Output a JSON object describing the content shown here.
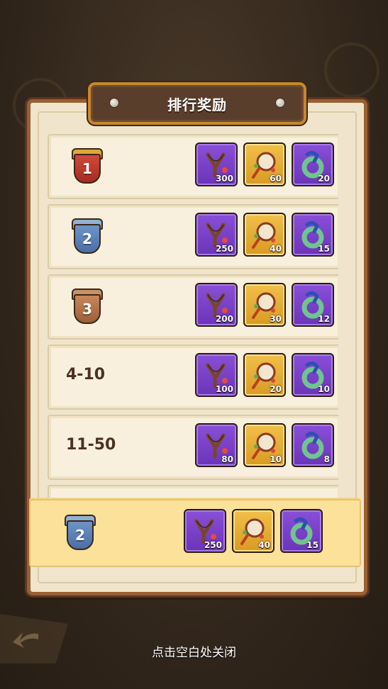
{
  "title": "排行奖励",
  "close_hint": "点击空白处关闭",
  "item_icons": [
    "slingshot-icon",
    "drum-icon",
    "jade-ring-icon"
  ],
  "colors": {
    "purple_frame": "#7a42c8",
    "gold_frame": "#e0a52b",
    "my_bar": "#fbe19a"
  },
  "rows": [
    {
      "rank": "1",
      "badge": "gold",
      "rewards": [
        "300",
        "60",
        "20"
      ]
    },
    {
      "rank": "2",
      "badge": "silver",
      "rewards": [
        "250",
        "40",
        "15"
      ]
    },
    {
      "rank": "3",
      "badge": "bronze",
      "rewards": [
        "200",
        "30",
        "12"
      ]
    },
    {
      "rank": "4-10",
      "badge": "text",
      "rewards": [
        "100",
        "20",
        "10"
      ]
    },
    {
      "rank": "11-50",
      "badge": "text",
      "rewards": [
        "80",
        "10",
        "8"
      ]
    }
  ],
  "my_rank": {
    "rank": "2",
    "badge": "silver",
    "rewards": [
      "250",
      "40",
      "15"
    ]
  }
}
